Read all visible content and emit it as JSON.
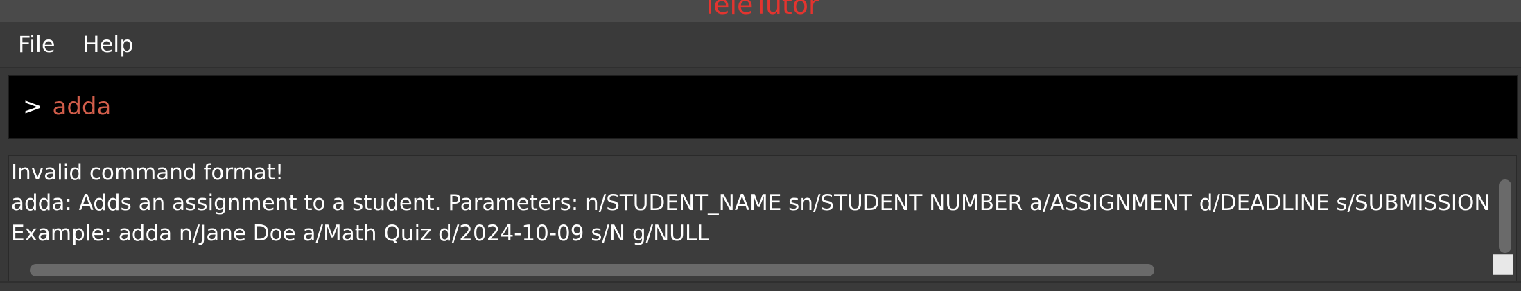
{
  "window": {
    "title": "TeleTutor"
  },
  "menu": {
    "items": [
      {
        "label": "File"
      },
      {
        "label": "Help"
      }
    ]
  },
  "command_box": {
    "prompt": ">",
    "value": "adda"
  },
  "result_display": {
    "lines": [
      "Invalid command format!",
      "adda: Adds an assignment to a student. Parameters: n/STUDENT_NAME sn/STUDENT NUMBER a/ASSIGNMENT d/DEADLINE s/SUBMISSION STA",
      "Example: adda n/Jane Doe a/Math Quiz d/2024-10-09 s/N g/NULL"
    ]
  },
  "colors": {
    "title": "#e3342f",
    "command_text": "#d25e4b",
    "background": "#3a3a3a",
    "command_background": "#000000"
  }
}
